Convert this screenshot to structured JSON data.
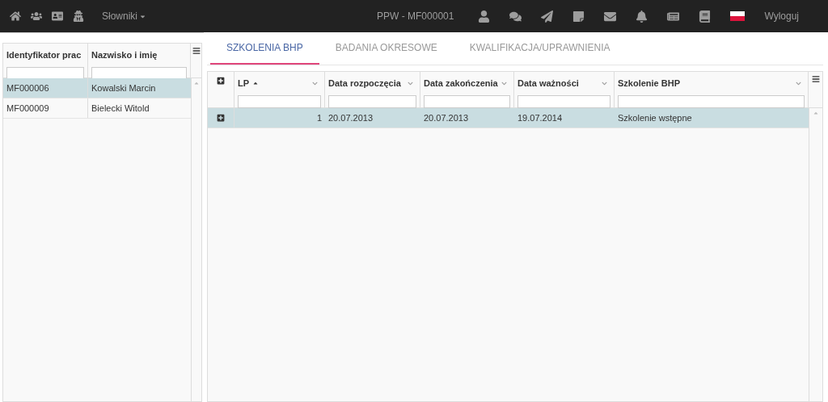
{
  "navbar": {
    "menu": "Słowniki",
    "user": "PPW - MF000001",
    "logout": "Wyloguj"
  },
  "employees": {
    "columns": [
      {
        "label": "Identyfikator prac"
      },
      {
        "label": "Nazwisko i imię"
      }
    ],
    "rows": [
      {
        "id": "MF000006",
        "name": "Kowalski Marcin",
        "selected": true
      },
      {
        "id": "MF000009",
        "name": "Bielecki Witold",
        "selected": false
      }
    ]
  },
  "tabs": [
    {
      "label": "SZKOLENIA BHP",
      "selected": true
    },
    {
      "label": "BADANIA OKRESOWE",
      "selected": false
    },
    {
      "label": "KWALIFIKACJA/UPRAWNIENIA",
      "selected": false
    }
  ],
  "trainings": {
    "columns": [
      {
        "label": "LP",
        "sorted": true
      },
      {
        "label": "Data rozpoczęcia",
        "sorted": false
      },
      {
        "label": "Data zakończenia",
        "sorted": false
      },
      {
        "label": "Data ważności",
        "sorted": false
      },
      {
        "label": "Szkolenie BHP",
        "sorted": false
      }
    ],
    "rows": [
      {
        "cells": [
          "1",
          "20.07.2013",
          "20.07.2013",
          "19.07.2014",
          "Szkolenie wstępne"
        ],
        "selected": true
      }
    ]
  }
}
